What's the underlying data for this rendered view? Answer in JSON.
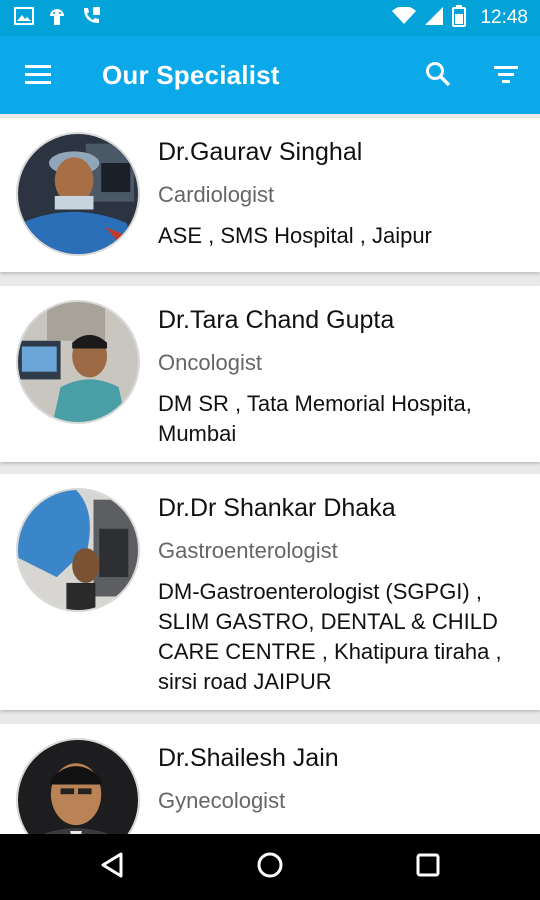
{
  "status_bar": {
    "time": "12:48"
  },
  "app_bar": {
    "title": "Our Specialist"
  },
  "specialists": [
    {
      "name": "Dr.Gaurav Singhal",
      "specialty": "Cardiologist",
      "details": "ASE , SMS Hospital , Jaipur"
    },
    {
      "name": "Dr.Tara Chand Gupta",
      "specialty": "Oncologist",
      "details": "DM SR , Tata Memorial Hospita, Mumbai"
    },
    {
      "name": "Dr.Dr Shankar Dhaka",
      "specialty": "Gastroenterologist",
      "details": "DM-Gastroenterologist (SGPGI) , SLIM GASTRO, DENTAL & CHILD CARE CENTRE , Khatipura tiraha , sirsi road JAIPUR"
    },
    {
      "name": "Dr.Shailesh Jain",
      "specialty": "Gynecologist",
      "details": ""
    }
  ],
  "colors": {
    "status_bar": "#03a2d9",
    "app_bar": "#0ba9ea",
    "nav_bar": "#000000"
  }
}
